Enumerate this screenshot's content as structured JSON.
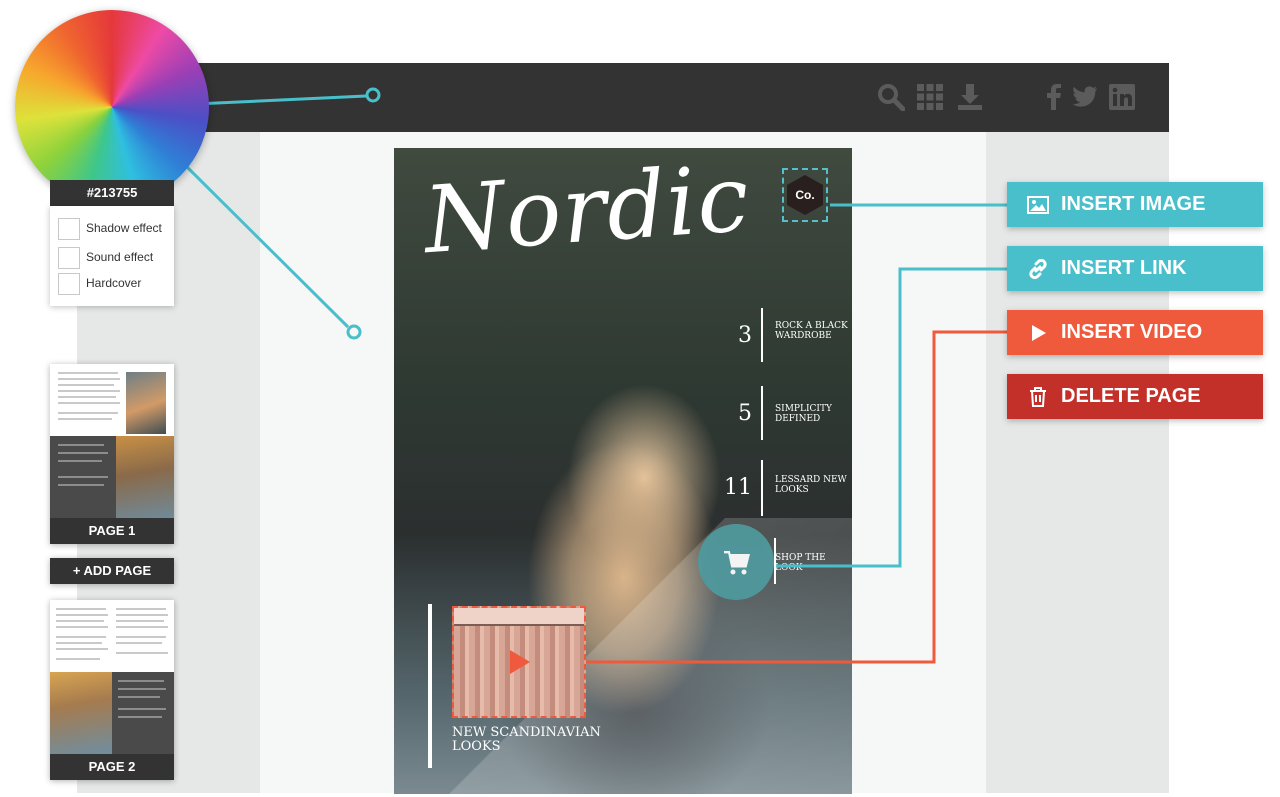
{
  "colors": {
    "topbar": "#333333",
    "teal": "#48bfca",
    "orange": "#f05a3c",
    "red": "#c3302a",
    "selected_color": "#213755"
  },
  "toolbar": {
    "icons": [
      "search-icon",
      "grid-icon",
      "download-icon",
      "facebook-icon",
      "twitter-icon",
      "linkedin-icon"
    ]
  },
  "color_picker": {
    "hex_value": "#213755",
    "options": [
      {
        "label": "Shadow effect"
      },
      {
        "label": "Sound effect"
      },
      {
        "label": "Hardcover"
      }
    ]
  },
  "pages": {
    "items": [
      {
        "label": "PAGE 1"
      },
      {
        "label": "PAGE 2"
      }
    ],
    "add_label": "+ ADD PAGE"
  },
  "magazine": {
    "title": "Nordic",
    "logo": "Co.",
    "toc": [
      {
        "num": "3",
        "text": "ROCK A BLACK WARDROBE"
      },
      {
        "num": "5",
        "text": "SIMPLICITY DEFINED"
      },
      {
        "num": "11",
        "text": "LESSARD NEW LOOKS"
      }
    ],
    "shop_text": "SHOP THE LOOK",
    "video_caption": "NEW SCANDINAVIAN LOOKS"
  },
  "actions": [
    {
      "label": "INSERT IMAGE",
      "icon": "image-icon"
    },
    {
      "label": "INSERT LINK",
      "icon": "link-icon"
    },
    {
      "label": "INSERT VIDEO",
      "icon": "play-icon"
    },
    {
      "label": "DELETE PAGE",
      "icon": "trash-icon"
    }
  ]
}
